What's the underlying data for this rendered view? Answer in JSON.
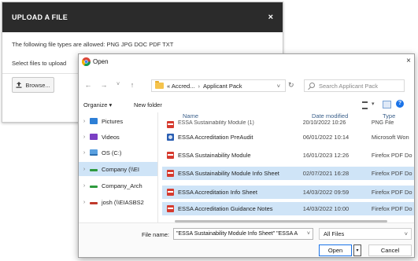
{
  "upload_modal": {
    "title": "UPLOAD A FILE",
    "close": "×",
    "allowed_text": "The following file types are allowed: PNG JPG DOC PDF TXT",
    "select_text": "Select files to upload",
    "browse_label": "Browse..."
  },
  "open_dialog": {
    "title": "Open",
    "close": "×",
    "nav": {
      "back": "←",
      "forward": "→",
      "down": "˅",
      "up": "↑"
    },
    "address": {
      "part1": "« Accred...",
      "sep": "›",
      "part2": "Applicant Pack",
      "chevron": "˅"
    },
    "refresh": "↻",
    "search_placeholder": "Search Applicant Pack",
    "organize_label": "Organize ▾",
    "new_folder_label": "New folder",
    "view_caret": "▾",
    "help": "?",
    "nav_pane": [
      {
        "label": "Pictures",
        "caret": "›"
      },
      {
        "label": "Videos",
        "caret": "›"
      },
      {
        "label": "OS (C:)",
        "caret": "›"
      },
      {
        "label": "Company (\\\\EI",
        "caret": "›"
      },
      {
        "label": "Company_Arch",
        "caret": "›"
      },
      {
        "label": "josh (\\\\EIASBS2",
        "caret": "›"
      }
    ],
    "columns": {
      "name": "Name",
      "date": "Date modified",
      "type": "Type"
    },
    "files": [
      {
        "name": "ESSA Sustainability Module (1)",
        "date": "20/10/2022 10:26",
        "type": "PNG File"
      },
      {
        "name": "ESSA Accreditation PreAudit",
        "date": "06/01/2022 10:14",
        "type": "Microsoft Won"
      },
      {
        "name": "ESSA Sustainability Module",
        "date": "16/01/2023 12:26",
        "type": "Firefox PDF Do"
      },
      {
        "name": "ESSA Sustainability Module Info Sheet",
        "date": "02/07/2021 16:28",
        "type": "Firefox PDF Do"
      },
      {
        "name": "ESSA Accreditation Info Sheet",
        "date": "14/03/2022 09:59",
        "type": "Firefox PDF Do"
      },
      {
        "name": "ESSA Accreditation Guidance Notes",
        "date": "14/03/2022 10:00",
        "type": "Firefox PDF Do"
      }
    ],
    "file_name_label": "File name:",
    "file_name_value": "\"ESSA Sustainability Module Info Sheet\" \"ESSA A",
    "file_name_caret": "˅",
    "file_type_value": "All Files",
    "file_type_caret": "˅",
    "open_label": "Open",
    "open_split": "▾",
    "cancel_label": "Cancel"
  },
  "colors": {
    "selection": "#cfe4f7",
    "accent": "#1a73e8",
    "header_dark": "#2b2b2b"
  }
}
